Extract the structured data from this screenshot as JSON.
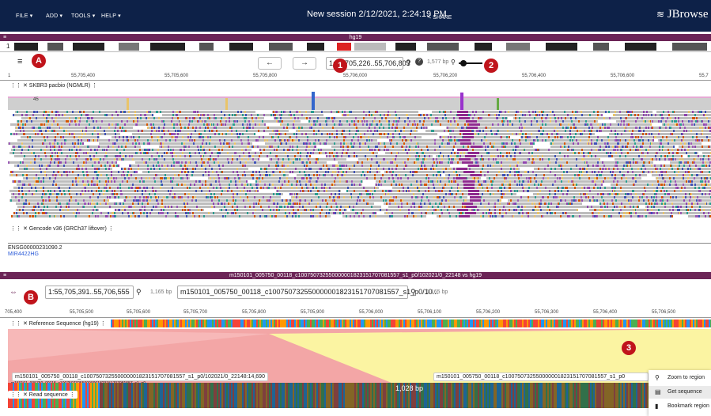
{
  "topbar": {
    "menus": [
      "FILE ▾",
      "ADD ▾",
      "TOOLS ▾",
      "HELP ▾"
    ],
    "session_title": "New session 2/12/2021, 2:24:19 PM",
    "share_label": "SHARE",
    "brand": "JBrowse"
  },
  "linear_view": {
    "assembly": "hg19",
    "chromosome": "1",
    "location": "1:55,705,226..55,706,803",
    "bp_label": "1,577 bp",
    "ruler_ticks": [
      "1",
      "55,705,400",
      "55,705,600",
      "55,705,800",
      "55,706,000",
      "55,706,200",
      "55,706,400",
      "55,706,600",
      "55,7"
    ],
    "coverage_label": "45",
    "tracks": {
      "alignments": "SKBR3 pacbio (NGMLR)",
      "genes": "Gencode v36 (GRCh37 liftover)"
    },
    "gene_labels": [
      "ENSG00000231090.2",
      "MIR4422HG"
    ]
  },
  "synteny_view": {
    "title": "m150101_005750_00118_c100750732550000001823151707081557_s1_p0/102021/0_22148 vs hg19",
    "left_location": "1:55,705,391..55,706,555",
    "left_bp": "1,165 bp",
    "right_location": "m150101_005750_00118_c100750732550000001823151707081557_s1_p0/10...",
    "right_bp": "1,165 bp",
    "ruler_ticks": [
      "705,400",
      "55,705,500",
      "55,705,600",
      "55,705,700",
      "55,705,800",
      "55,705,900",
      "55,706,000",
      "55,706,100",
      "55,706,200",
      "55,706,300",
      "55,706,400",
      "55,706,500"
    ],
    "tracks": {
      "reference": "Reference Sequence (hg19)",
      "read": "Read sequence"
    },
    "read_label_left": "m150101_005750_00118_c100750732550000001823151707081557_s1_p0/102021/0_22148:14,690",
    "read_label_right": "m150101_005750_00118_c100750732550000001823151707081557_s1_p0",
    "read_label_small": "m150101_005750_00118_c100750732550000001823151707081557_s1_p0",
    "selection_bp": "1,028 bp"
  },
  "context_menu": {
    "items": [
      "Zoom to region",
      "Get sequence",
      "Bookmark region"
    ]
  },
  "callouts": [
    "A",
    "1",
    "2",
    "B",
    "3"
  ],
  "colors": {
    "topbar": "#0d2148",
    "view_header": "#6b2456",
    "callout": "#c0141b",
    "synteny_pink": "#f3a6a6",
    "synteny_yellow": "#fbf4a2"
  }
}
